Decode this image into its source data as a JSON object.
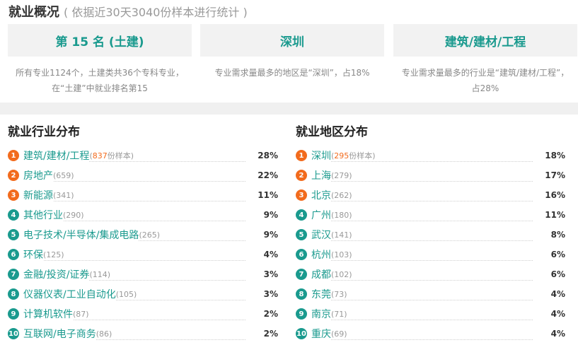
{
  "overview": {
    "title": "就业概况",
    "subtitle": "( 依据近30天3040份样本进行统计 )"
  },
  "summary_cards": [
    {
      "headline": "第 15 名 (土建)",
      "description": "所有专业1124个，土建类共36个专科专业，在“土建”中就业排名第15"
    },
    {
      "headline": "深圳",
      "description": "专业需求量最多的地区是“深圳”，占18%"
    },
    {
      "headline": "建筑/建材/工程",
      "description": "专业需求量最多的行业是“建筑/建材/工程”，占28%"
    }
  ],
  "industry": {
    "title": "就业行业分布",
    "items": [
      {
        "rank": "1",
        "name": "建筑/建材/工程",
        "count_prefix": "(",
        "count_num": "837",
        "count_suffix": "份样本)",
        "pct": "28%"
      },
      {
        "rank": "2",
        "name": "房地产",
        "count_prefix": "(659)",
        "count_num": "",
        "count_suffix": "",
        "pct": "22%"
      },
      {
        "rank": "3",
        "name": "新能源",
        "count_prefix": "(341)",
        "count_num": "",
        "count_suffix": "",
        "pct": "11%"
      },
      {
        "rank": "4",
        "name": "其他行业",
        "count_prefix": "(290)",
        "count_num": "",
        "count_suffix": "",
        "pct": "9%"
      },
      {
        "rank": "5",
        "name": "电子技术/半导体/集成电路",
        "count_prefix": "(265)",
        "count_num": "",
        "count_suffix": "",
        "pct": "9%"
      },
      {
        "rank": "6",
        "name": "环保",
        "count_prefix": "(125)",
        "count_num": "",
        "count_suffix": "",
        "pct": "4%"
      },
      {
        "rank": "7",
        "name": "金融/投资/证券",
        "count_prefix": "(114)",
        "count_num": "",
        "count_suffix": "",
        "pct": "3%"
      },
      {
        "rank": "8",
        "name": "仪器仪表/工业自动化",
        "count_prefix": "(105)",
        "count_num": "",
        "count_suffix": "",
        "pct": "3%"
      },
      {
        "rank": "9",
        "name": "计算机软件",
        "count_prefix": "(87)",
        "count_num": "",
        "count_suffix": "",
        "pct": "2%"
      },
      {
        "rank": "10",
        "name": "互联网/电子商务",
        "count_prefix": "(86)",
        "count_num": "",
        "count_suffix": "",
        "pct": "2%"
      }
    ]
  },
  "region": {
    "title": "就业地区分布",
    "items": [
      {
        "rank": "1",
        "name": "深圳",
        "count_prefix": "(",
        "count_num": "295",
        "count_suffix": "份样本)",
        "pct": "18%"
      },
      {
        "rank": "2",
        "name": "上海",
        "count_prefix": "(279)",
        "count_num": "",
        "count_suffix": "",
        "pct": "17%"
      },
      {
        "rank": "3",
        "name": "北京",
        "count_prefix": "(262)",
        "count_num": "",
        "count_suffix": "",
        "pct": "16%"
      },
      {
        "rank": "4",
        "name": "广州",
        "count_prefix": "(180)",
        "count_num": "",
        "count_suffix": "",
        "pct": "11%"
      },
      {
        "rank": "5",
        "name": "武汉",
        "count_prefix": "(141)",
        "count_num": "",
        "count_suffix": "",
        "pct": "8%"
      },
      {
        "rank": "6",
        "name": "杭州",
        "count_prefix": "(103)",
        "count_num": "",
        "count_suffix": "",
        "pct": "6%"
      },
      {
        "rank": "7",
        "name": "成都",
        "count_prefix": "(102)",
        "count_num": "",
        "count_suffix": "",
        "pct": "6%"
      },
      {
        "rank": "8",
        "name": "东莞",
        "count_prefix": "(73)",
        "count_num": "",
        "count_suffix": "",
        "pct": "4%"
      },
      {
        "rank": "9",
        "name": "南京",
        "count_prefix": "(71)",
        "count_num": "",
        "count_suffix": "",
        "pct": "4%"
      },
      {
        "rank": "10",
        "name": "重庆",
        "count_prefix": "(69)",
        "count_num": "",
        "count_suffix": "",
        "pct": "4%"
      }
    ]
  },
  "colors": {
    "accent": "#1a9a8e",
    "top_rank": "#f26b1d",
    "muted": "#999999"
  }
}
